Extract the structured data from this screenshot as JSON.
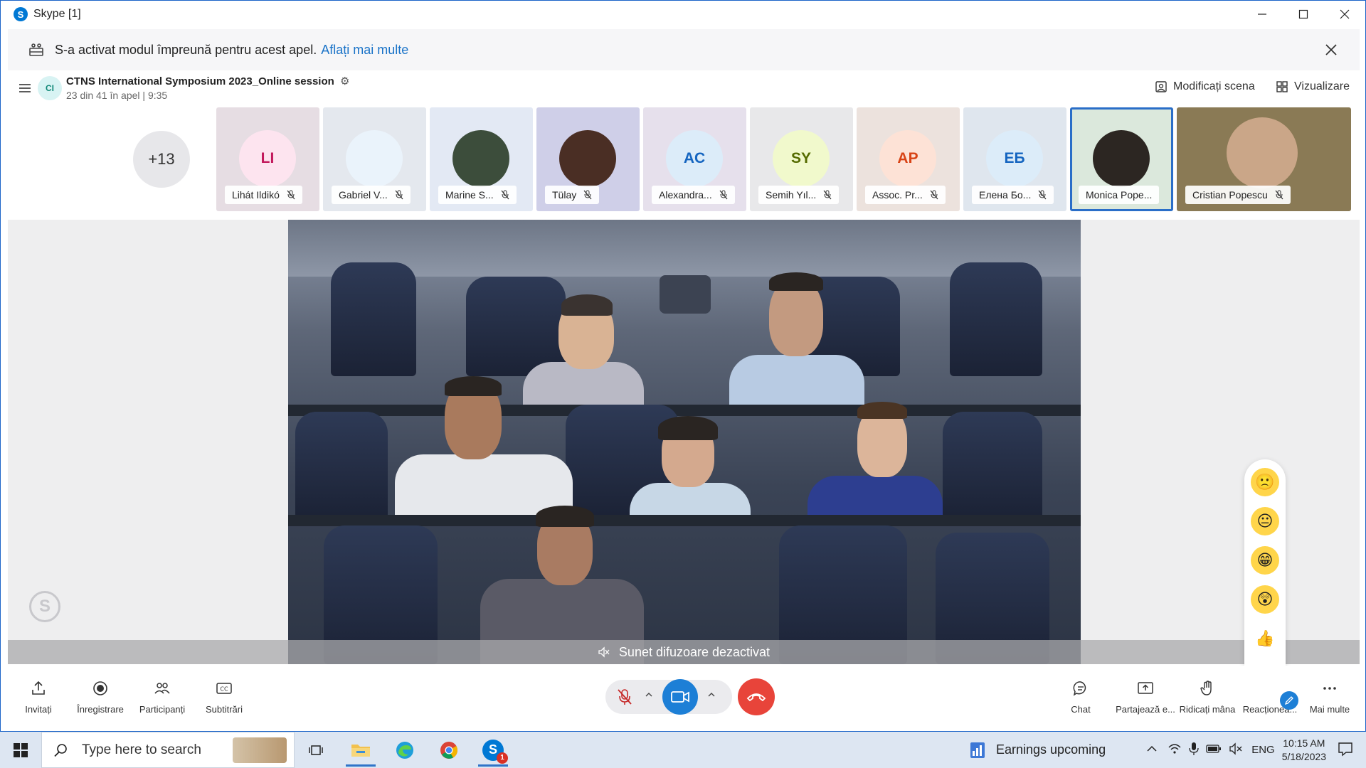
{
  "window": {
    "title": "Skype [1]"
  },
  "notice": {
    "text": "S-a activat modul împreună pentru acest apel.",
    "link": "Aflați mai multe"
  },
  "call": {
    "avatar_initials": "CI",
    "title": "CTNS International Symposium 2023_Online session",
    "subtitle": "23 din 41 în apel | 9:35",
    "change_scene": "Modificați scena",
    "view": "Vizualizare",
    "more_participants": "+13"
  },
  "participants": [
    {
      "name": "Lihát Ildikó",
      "initials": "LI",
      "bg": "#e6dde3",
      "avbg": "#fde4ef",
      "avcolor": "#c2185b"
    },
    {
      "name": "Gabriel V...",
      "initials": "",
      "bg": "#e4e8ee",
      "avbg": "#eaf3fb",
      "avcolor": "#d9583a"
    },
    {
      "name": "Marine S...",
      "initials": "",
      "bg": "#e3e9f4",
      "avbg": "#3c4d3b",
      "avcolor": "#fff"
    },
    {
      "name": "Tülay",
      "initials": "",
      "bg": "#cfcfe8",
      "avbg": "#4a2e24",
      "avcolor": "#fff"
    },
    {
      "name": "Alexandra...",
      "initials": "AC",
      "bg": "#e6e0ec",
      "avbg": "#dcecf9",
      "avcolor": "#1565c0"
    },
    {
      "name": "Semih Yıl...",
      "initials": "SY",
      "bg": "#e8e8ea",
      "avbg": "#f1f9cc",
      "avcolor": "#556b00"
    },
    {
      "name": "Assoc. Pr...",
      "initials": "AP",
      "bg": "#ece2dd",
      "avbg": "#fde2d6",
      "avcolor": "#d84315"
    },
    {
      "name": "Елена Бо...",
      "initials": "ЕБ",
      "bg": "#dfe6ee",
      "avbg": "#dcecf9",
      "avcolor": "#1565c0"
    },
    {
      "name": "Monica Pope...",
      "initials": "",
      "bg": "#dbe8dc",
      "avbg": "#2c2622",
      "avcolor": "#fff"
    },
    {
      "name": "Cristian Popescu",
      "initials": "",
      "bg": "#8a7a55",
      "avbg": "#caa688",
      "avcolor": "#fff"
    }
  ],
  "stage": {
    "mute_banner": "Sunet difuzoare dezactivat"
  },
  "controls": {
    "invite": "Invitați",
    "record": "Înregistrare",
    "participants": "Participanți",
    "subtitles": "Subtitrări",
    "chat": "Chat",
    "share": "Partajează e...",
    "raise_hand": "Ridicați mâna",
    "react": "Reacționea...",
    "more": "Mai multe"
  },
  "taskbar": {
    "search_placeholder": "Type here to search",
    "news": "Earnings upcoming",
    "lang": "ENG",
    "time": "10:15 AM",
    "date": "5/18/2023",
    "skype_badge": "1"
  }
}
